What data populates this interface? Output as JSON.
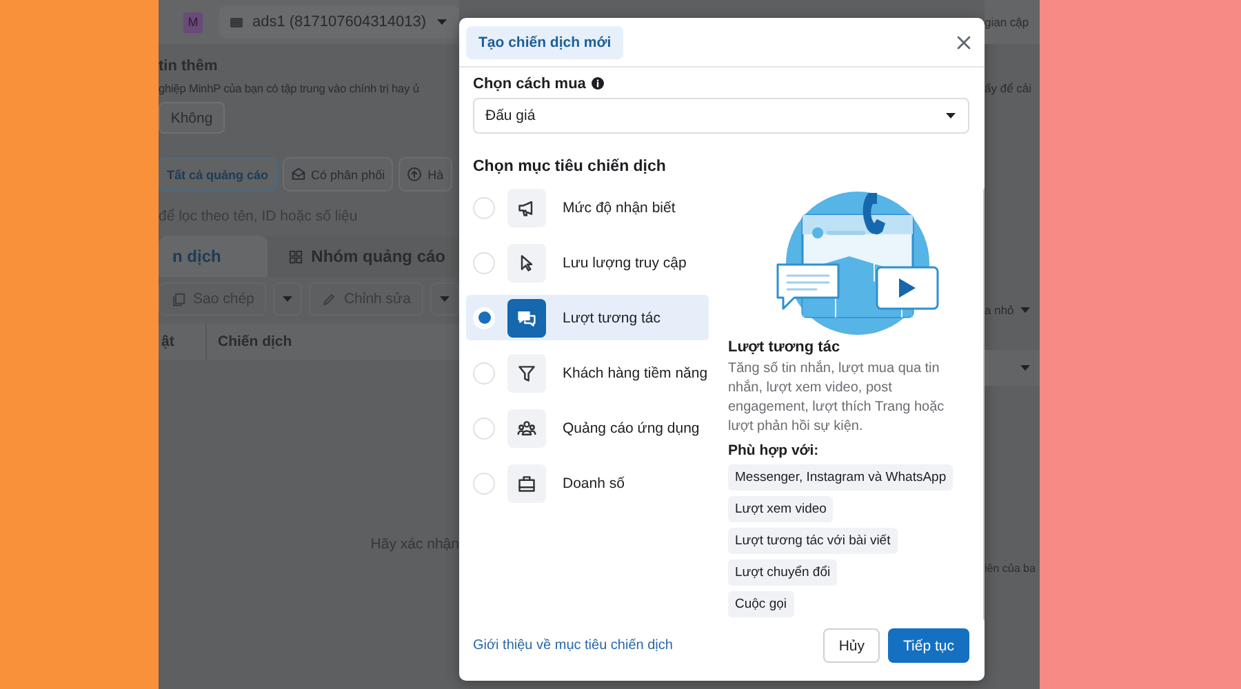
{
  "background_page": {
    "account_badge": "M",
    "account_selector": {
      "value": "ads1 (817107604314013)"
    },
    "top_right_text": "gian cập",
    "notice": {
      "title": "tin thêm",
      "text": "ghiệp MinhP của bạn có tập trung vào chính trị hay ủ",
      "text_right": "ấy để cải",
      "button": "Không"
    },
    "filters": [
      {
        "label": "Tất cả quảng cáo",
        "selected": true
      },
      {
        "label": "Có phân phối",
        "selected": false
      },
      {
        "label": "Hà",
        "selected": false
      }
    ],
    "search": {
      "placeholder": "để lọc theo tên, ID hoặc số liệu"
    },
    "tabs": [
      {
        "label": "n dịch",
        "selected": true
      },
      {
        "label": "Nhóm quảng cáo",
        "selected": false
      }
    ],
    "toolbar": [
      {
        "label": "Sao chép",
        "kind": "copy"
      },
      {
        "label": "Chỉnh sửa",
        "kind": "edit"
      }
    ],
    "toolbar_right": "a nhỏ",
    "columns": [
      "ật",
      "Chiến dịch"
    ],
    "empty_text_left": "Hãy xác nhận",
    "empty_text_right": "iên của ba"
  },
  "dialog": {
    "tab": {
      "label": "Tạo chiến dịch mới",
      "selected": true
    },
    "buy_type": {
      "label": "Chọn cách mua",
      "value": "Đấu giá"
    },
    "objective_heading": "Chọn mục tiêu chiến dịch",
    "objectives": [
      {
        "label": "Mức độ nhận biết",
        "kind": "megaphone",
        "selected": false
      },
      {
        "label": "Lưu lượng truy cập",
        "kind": "cursor",
        "selected": false
      },
      {
        "label": "Lượt tương tác",
        "kind": "chat",
        "selected": true
      },
      {
        "label": "Khách hàng tiềm năng",
        "kind": "filter",
        "selected": false
      },
      {
        "label": "Quảng cáo ứng dụng",
        "kind": "people",
        "selected": false
      },
      {
        "label": "Doanh số",
        "kind": "bag",
        "selected": false
      }
    ],
    "detail": {
      "title": "Lượt tương tác",
      "description": "Tăng số tin nhắn, lượt mua qua tin nhắn, lượt xem video, post engagement, lượt thích Trang hoặc lượt phản hồi sự kiện.",
      "fit_label": "Phù hợp với:",
      "fits": [
        "Messenger, Instagram và WhatsApp",
        "Lượt xem video",
        "Lượt tương tác với bài viết",
        "Lượt chuyển đổi",
        "Cuộc gọi"
      ]
    },
    "learn_link": "Giới thiệu về mục tiêu chiến dịch",
    "buttons": [
      {
        "label": "Hủy",
        "kind": "secondary"
      },
      {
        "label": "Tiếp tục",
        "kind": "primary"
      }
    ]
  }
}
